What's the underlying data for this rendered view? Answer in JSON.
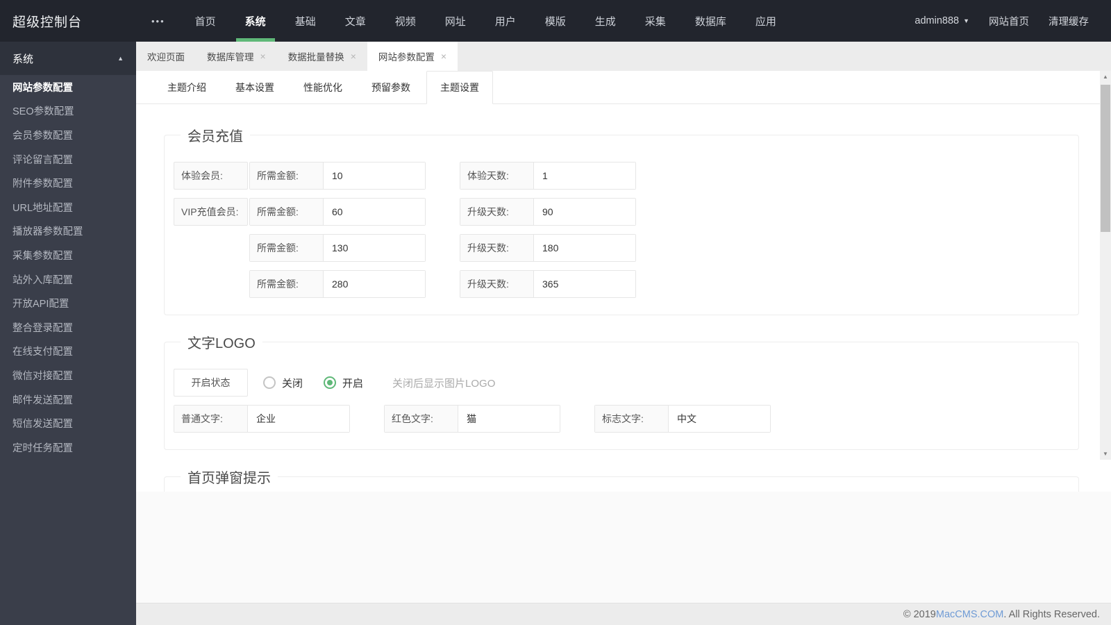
{
  "topbar": {
    "brand": "超级控制台",
    "more_icon": "•••",
    "menu": [
      {
        "label": "首页"
      },
      {
        "label": "系统"
      },
      {
        "label": "基础"
      },
      {
        "label": "文章"
      },
      {
        "label": "视频"
      },
      {
        "label": "网址"
      },
      {
        "label": "用户"
      },
      {
        "label": "模版"
      },
      {
        "label": "生成"
      },
      {
        "label": "采集"
      },
      {
        "label": "数据库"
      },
      {
        "label": "应用"
      }
    ],
    "active_menu": "系统",
    "user": "admin888",
    "site_home": "网站首页",
    "clear_cache": "清理缓存"
  },
  "sidebar": {
    "header": "系统",
    "active_item": "网站参数配置",
    "items": [
      {
        "label": "网站参数配置"
      },
      {
        "label": "SEO参数配置"
      },
      {
        "label": "会员参数配置"
      },
      {
        "label": "评论留言配置"
      },
      {
        "label": "附件参数配置"
      },
      {
        "label": "URL地址配置"
      },
      {
        "label": "播放器参数配置"
      },
      {
        "label": "采集参数配置"
      },
      {
        "label": "站外入库配置"
      },
      {
        "label": "开放API配置"
      },
      {
        "label": "整合登录配置"
      },
      {
        "label": "在线支付配置"
      },
      {
        "label": "微信对接配置"
      },
      {
        "label": "邮件发送配置"
      },
      {
        "label": "短信发送配置"
      },
      {
        "label": "定时任务配置"
      }
    ]
  },
  "tabs": [
    {
      "label": "欢迎页面",
      "closable": false,
      "active": false
    },
    {
      "label": "数据库管理",
      "closable": true,
      "active": false
    },
    {
      "label": "数据批量替换",
      "closable": true,
      "active": false
    },
    {
      "label": "网站参数配置",
      "closable": true,
      "active": true
    }
  ],
  "close_glyph": "×",
  "subtabs": [
    {
      "label": "主题介绍",
      "active": false
    },
    {
      "label": "基本设置",
      "active": false
    },
    {
      "label": "性能优化",
      "active": false
    },
    {
      "label": "预留参数",
      "active": false
    },
    {
      "label": "主题设置",
      "active": true
    }
  ],
  "sections": {
    "member": {
      "legend": "会员充值",
      "rows": [
        {
          "group": "体验会员:",
          "amount_label": "所需金额:",
          "amount": "10",
          "days_label": "体验天数:",
          "days": "1"
        },
        {
          "group": "VIP充值会员:",
          "amount_label": "所需金额:",
          "amount": "60",
          "days_label": "升级天数:",
          "days": "90"
        },
        {
          "group": "",
          "amount_label": "所需金额:",
          "amount": "130",
          "days_label": "升级天数:",
          "days": "180"
        },
        {
          "group": "",
          "amount_label": "所需金额:",
          "amount": "280",
          "days_label": "升级天数:",
          "days": "365"
        }
      ]
    },
    "logo": {
      "legend": "文字LOGO",
      "status_label": "开启状态",
      "radio_off": "关闭",
      "radio_on": "开启",
      "radio_selected": "开启",
      "hint": "关闭后显示图片LOGO",
      "fields": [
        {
          "label": "普通文字:",
          "value": "企业"
        },
        {
          "label": "红色文字:",
          "value": "猫"
        },
        {
          "label": "标志文字:",
          "value": "中文"
        }
      ]
    },
    "popup": {
      "legend": "首页弹窗提示"
    }
  },
  "footer": {
    "prefix": "© 2019 ",
    "link": "MacCMS.COM",
    "suffix": ". All Rights Reserved."
  },
  "colors": {
    "accent_green": "#5FB878",
    "topbar_bg": "#22252D",
    "sidebar_bg": "#3A3E4A",
    "sidebar_header_bg": "#2E323C",
    "link_blue": "#6F9BD5"
  }
}
